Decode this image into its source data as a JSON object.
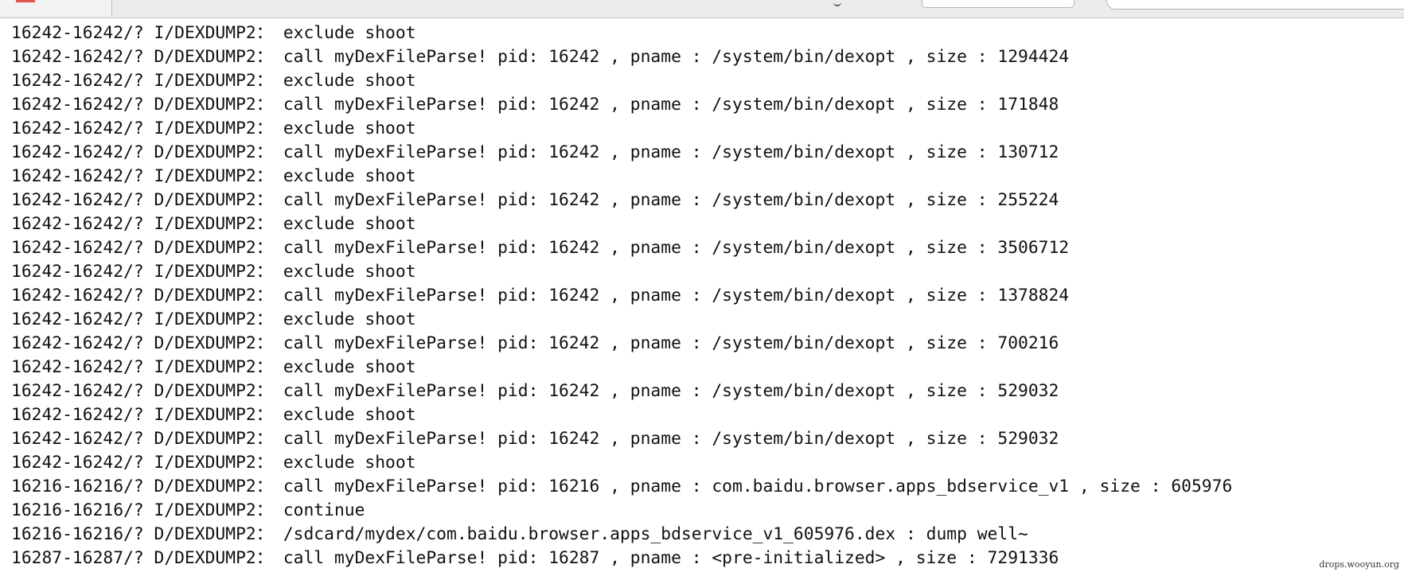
{
  "log": {
    "lines": [
      "16242-16242/? I/DEXDUMP2： exclude shoot",
      "16242-16242/? D/DEXDUMP2： call myDexFileParse! pid: 16242 , pname : /system/bin/dexopt , size : 1294424",
      "16242-16242/? I/DEXDUMP2： exclude shoot",
      "16242-16242/? D/DEXDUMP2： call myDexFileParse! pid: 16242 , pname : /system/bin/dexopt , size : 171848",
      "16242-16242/? I/DEXDUMP2： exclude shoot",
      "16242-16242/? D/DEXDUMP2： call myDexFileParse! pid: 16242 , pname : /system/bin/dexopt , size : 130712",
      "16242-16242/? I/DEXDUMP2： exclude shoot",
      "16242-16242/? D/DEXDUMP2： call myDexFileParse! pid: 16242 , pname : /system/bin/dexopt , size : 255224",
      "16242-16242/? I/DEXDUMP2： exclude shoot",
      "16242-16242/? D/DEXDUMP2： call myDexFileParse! pid: 16242 , pname : /system/bin/dexopt , size : 3506712",
      "16242-16242/? I/DEXDUMP2： exclude shoot",
      "16242-16242/? D/DEXDUMP2： call myDexFileParse! pid: 16242 , pname : /system/bin/dexopt , size : 1378824",
      "16242-16242/? I/DEXDUMP2： exclude shoot",
      "16242-16242/? D/DEXDUMP2： call myDexFileParse! pid: 16242 , pname : /system/bin/dexopt , size : 700216",
      "16242-16242/? I/DEXDUMP2： exclude shoot",
      "16242-16242/? D/DEXDUMP2： call myDexFileParse! pid: 16242 , pname : /system/bin/dexopt , size : 529032",
      "16242-16242/? I/DEXDUMP2： exclude shoot",
      "16242-16242/? D/DEXDUMP2： call myDexFileParse! pid: 16242 , pname : /system/bin/dexopt , size : 529032",
      "16242-16242/? I/DEXDUMP2： exclude shoot",
      "16216-16216/? D/DEXDUMP2： call myDexFileParse! pid: 16216 , pname : com.baidu.browser.apps_bdservice_v1 , size : 605976",
      "16216-16216/? I/DEXDUMP2： continue",
      "16216-16216/? D/DEXDUMP2： /sdcard/mydex/com.baidu.browser.apps_bdservice_v1_605976.dex : dump well~",
      "16287-16287/? D/DEXDUMP2： call myDexFileParse! pid: 16287 , pname : <pre-initialized> , size : 7291336"
    ]
  },
  "watermark": {
    "text": "drops.wooyun.org"
  },
  "colors": {
    "text": "#111111",
    "background": "#ffffff",
    "toolbar": "#ececec",
    "close_accent": "#e0554f"
  }
}
